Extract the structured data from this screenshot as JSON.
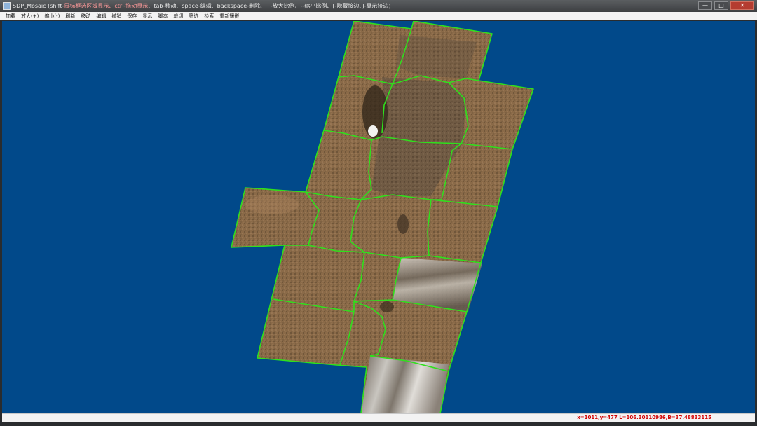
{
  "window": {
    "title_prefix": "SDP_Mosaic (shift-",
    "title_highlight": "鼠标框选区域显示、ctrl-拖动显示",
    "title_suffix": "、tab-移动、space-编辑、backspace-删除、+-放大比例、--缩小比例、[-隐藏接边、]-显示接边)",
    "minimize_label": "—",
    "maximize_label": "□",
    "close_label": "✕"
  },
  "menu": {
    "items": [
      "加载",
      "放大(+)",
      "缩小(-)",
      "刷新",
      "移动",
      "编辑",
      "撤销",
      "保存",
      "显示",
      "脚本",
      "裁切",
      "筛选",
      "检索",
      "重新镶嵌"
    ]
  },
  "status": {
    "coords": "x=1011,y=477 L=106.30110986,B=37.48833115"
  },
  "colors": {
    "canvas_bg": "#01498a",
    "seamline": "#2fe01c",
    "status_text": "#d40000"
  }
}
